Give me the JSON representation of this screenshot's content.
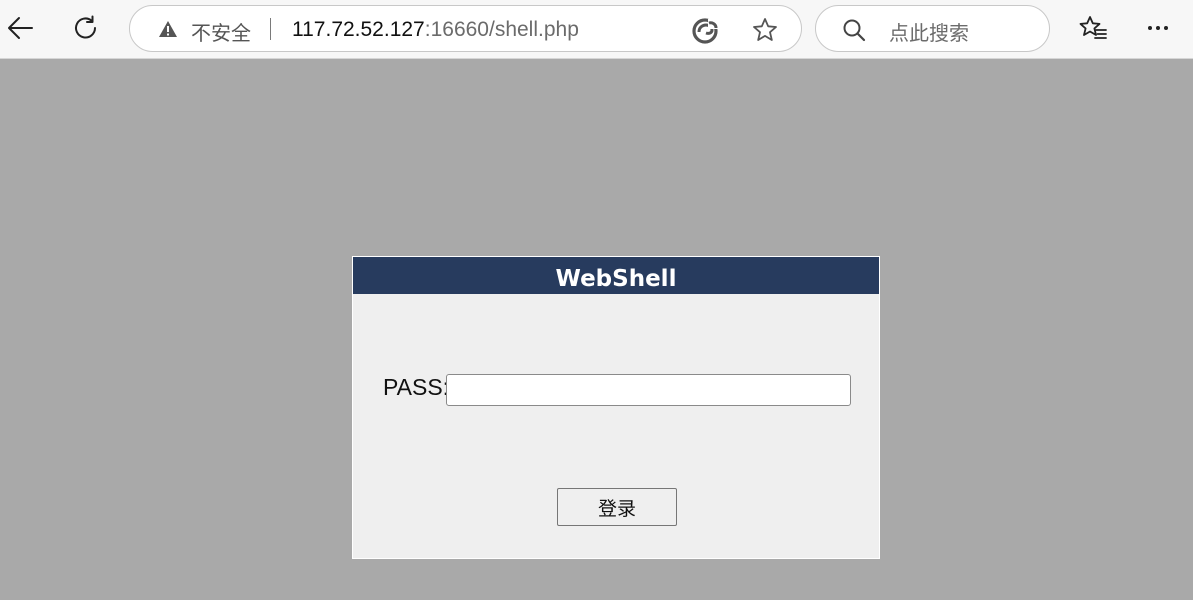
{
  "browser": {
    "security_label": "不安全",
    "url_host": "117.72.52.127",
    "url_rest": ":16660/shell.php",
    "search_placeholder": "点此搜索",
    "icons": [
      "back-icon",
      "refresh-icon",
      "warning-icon",
      "read-aloud-icon",
      "star-icon",
      "search-icon",
      "favorites-icon",
      "more-icon"
    ]
  },
  "page": {
    "background_color": "#a9a9a9",
    "panel": {
      "title": "WebShell",
      "header_color": "#273b5e",
      "pass_label": "PASS:",
      "pass_value": "",
      "login_button": "登录"
    }
  }
}
